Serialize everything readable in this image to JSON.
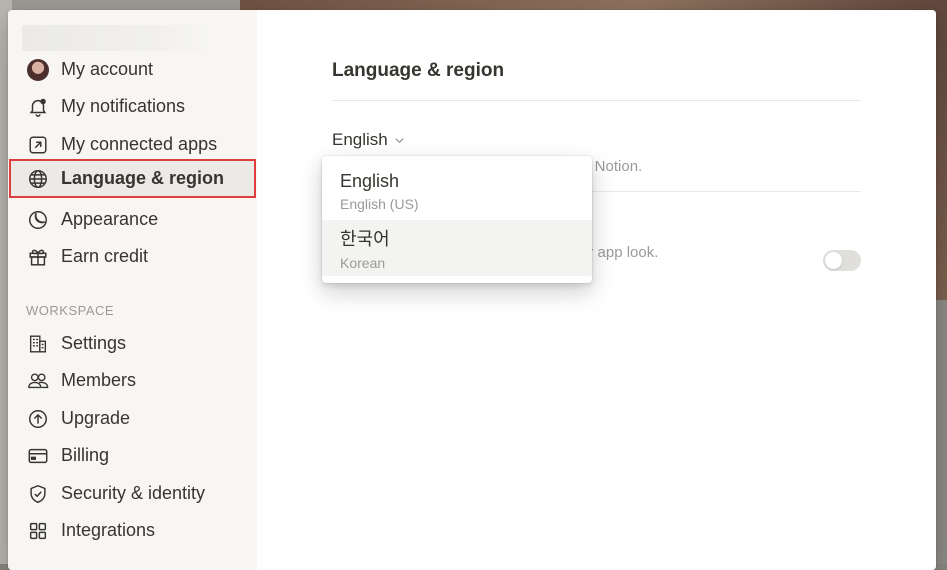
{
  "sidebar": {
    "account_items": [
      {
        "label": "My account",
        "icon": "avatar"
      },
      {
        "label": "My notifications",
        "icon": "bell-icon"
      },
      {
        "label": "My connected apps",
        "icon": "arrow-up-right-box-icon"
      },
      {
        "label": "Language & region",
        "icon": "globe-icon"
      },
      {
        "label": "Appearance",
        "icon": "moon-icon"
      },
      {
        "label": "Earn credit",
        "icon": "gift-icon"
      }
    ],
    "workspace_label": "WORKSPACE",
    "workspace_items": [
      {
        "label": "Settings",
        "icon": "building-icon"
      },
      {
        "label": "Members",
        "icon": "people-icon"
      },
      {
        "label": "Upgrade",
        "icon": "arrow-up-circle-icon"
      },
      {
        "label": "Billing",
        "icon": "credit-card-icon"
      },
      {
        "label": "Security & identity",
        "icon": "shield-check-icon"
      },
      {
        "label": "Integrations",
        "icon": "grid-icon"
      }
    ],
    "active_item": "Language & region"
  },
  "content": {
    "heading": "Language & region",
    "language_value": "English",
    "language_desc_visible": "th Notion.",
    "appearance_desc_visible": "ur app look.",
    "toggle_on": false
  },
  "dropdown": {
    "options": [
      {
        "label": "English",
        "sublabel": "English (US)"
      },
      {
        "label": "한국어",
        "sublabel": "Korean"
      }
    ],
    "hovered_index": 1
  }
}
